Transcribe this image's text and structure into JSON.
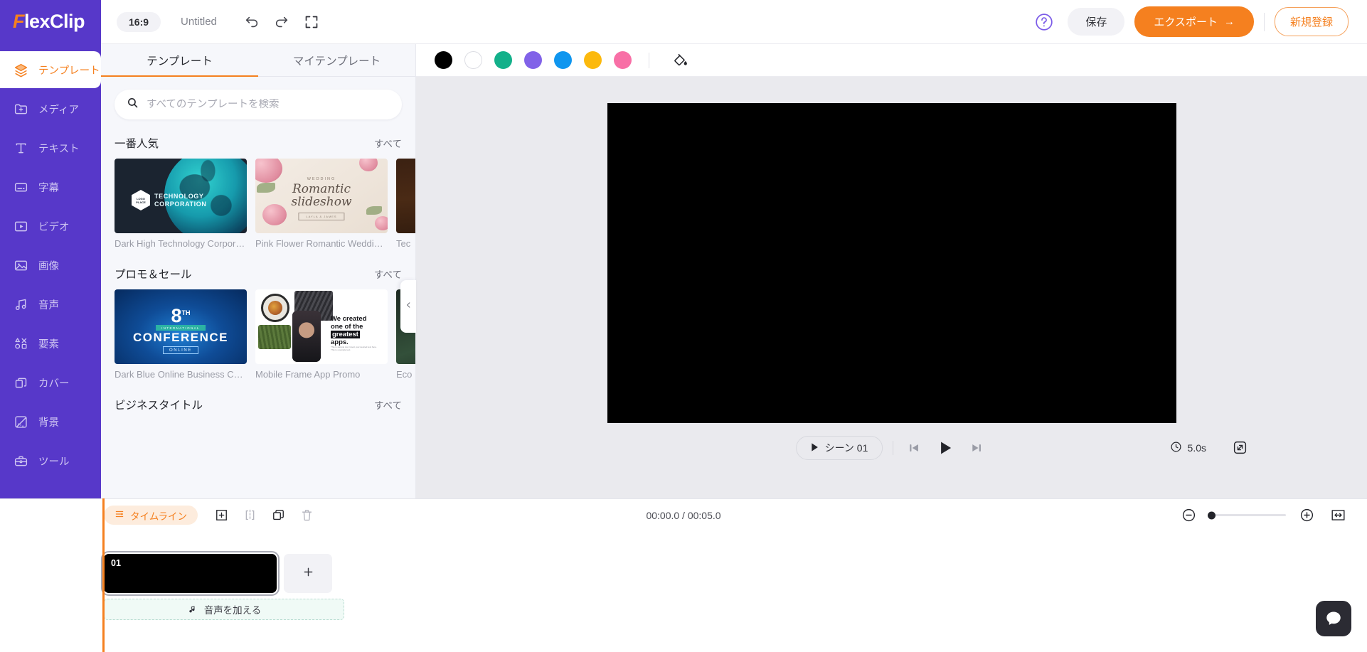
{
  "app": {
    "logo_f": "F",
    "logo_rest": "lexClip"
  },
  "header": {
    "ratio": "16:9",
    "project_title": "Untitled",
    "undo_icon": "undo-icon",
    "redo_icon": "redo-icon",
    "fullscreen_icon": "expand-icon",
    "help_icon": "help-circle-icon",
    "save_label": "保存",
    "export_label": "エクスポート",
    "export_arrow": "→",
    "signup_label": "新規登録"
  },
  "sidebar": {
    "items": [
      {
        "label": "テンプレート",
        "icon": "layers-icon",
        "active": true
      },
      {
        "label": "メディア",
        "icon": "media-folder-icon",
        "active": false
      },
      {
        "label": "テキスト",
        "icon": "text-t-icon",
        "active": false
      },
      {
        "label": "字幕",
        "icon": "subtitle-icon",
        "active": false
      },
      {
        "label": "ビデオ",
        "icon": "video-play-icon",
        "active": false
      },
      {
        "label": "画像",
        "icon": "image-icon",
        "active": false
      },
      {
        "label": "音声",
        "icon": "music-note-icon",
        "active": false
      },
      {
        "label": "要素",
        "icon": "shapes-icon",
        "active": false
      },
      {
        "label": "カバー",
        "icon": "cover-layers-icon",
        "active": false
      },
      {
        "label": "背景",
        "icon": "background-icon",
        "active": false
      },
      {
        "label": "ツール",
        "icon": "toolbox-icon",
        "active": false
      }
    ]
  },
  "panel": {
    "tabs": [
      {
        "label": "テンプレート",
        "active": true
      },
      {
        "label": "マイテンプレート",
        "active": false
      }
    ],
    "search": {
      "placeholder": "すべてのテンプレートを検索",
      "value": "",
      "icon": "search-icon"
    },
    "see_all_label": "すべて",
    "collapse_icon": "chevron-left-icon",
    "sections": [
      {
        "title": "一番人気",
        "see_all": "すべて",
        "cards": [
          {
            "name": "Dark High Technology Corporate...",
            "art": "tech",
            "art_text": {
              "line1": "TECHNOLOGY",
              "line2": "CORPORATION",
              "logo1": "LOGO",
              "logo2": "PLACE"
            }
          },
          {
            "name": "Pink Flower Romantic Wedding ...",
            "art": "wedding",
            "art_text": {
              "kicker": "WEDDING",
              "title1": "Romantic",
              "title2": "slideshow",
              "sub": "LAYLA & JAMES"
            }
          },
          {
            "name": "Tec",
            "art": "brown",
            "art_text": {}
          }
        ]
      },
      {
        "title": "プロモ＆セール",
        "see_all": "すべて",
        "cards": [
          {
            "name": "Dark Blue Online Business Confe...",
            "art": "conference",
            "art_text": {
              "num": "8",
              "sup": "TH",
              "band": "INTERNATIONAL",
              "main": "CONFERENCE",
              "online": "ONLINE"
            }
          },
          {
            "name": "Mobile Frame App Promo",
            "art": "app",
            "art_text": {
              "l1": "We created",
              "l2": "one of the",
              "l3": "greatest",
              "l4": "apps.",
              "fine": "This is sample text. Insert your desired text here. This is a sample text."
            }
          },
          {
            "name": "Eco",
            "art": "eco",
            "art_text": {}
          }
        ]
      },
      {
        "title": "ビジネスタイトル",
        "see_all": "すべて",
        "cards": []
      }
    ]
  },
  "stage": {
    "colors": [
      {
        "name": "black-swatch",
        "hex": "#000000"
      },
      {
        "name": "white-swatch",
        "hex": "#ffffff"
      },
      {
        "name": "green-swatch",
        "hex": "#13b08a"
      },
      {
        "name": "purple-swatch",
        "hex": "#8162e8"
      },
      {
        "name": "blue-swatch",
        "hex": "#0f96ef"
      },
      {
        "name": "yellow-swatch",
        "hex": "#fcb90d"
      },
      {
        "name": "pink-swatch",
        "hex": "#f86fa6"
      }
    ],
    "fill_icon": "paint-bucket-icon",
    "canvas_color": "#000000"
  },
  "player": {
    "scene_label": "シーン 01",
    "scene_play_icon": "play-small-icon",
    "prev_icon": "skip-previous-icon",
    "play_icon": "play-icon",
    "next_icon": "skip-next-icon",
    "clock_icon": "clock-icon",
    "duration": "5.0s",
    "expand_icon": "expand-arrows-icon"
  },
  "timeline": {
    "mode_label": "タイムライン",
    "mode_icon": "timeline-icon",
    "tools": [
      {
        "name": "add-clip-button",
        "icon": "plus-square-icon"
      },
      {
        "name": "split-clip-button",
        "icon": "split-icon"
      },
      {
        "name": "duplicate-clip-button",
        "icon": "duplicate-icon"
      },
      {
        "name": "delete-clip-button",
        "icon": "trash-icon"
      }
    ],
    "time_display": "00:00.0 / 00:05.0",
    "zoom_out_icon": "minus-circle-icon",
    "zoom_in_icon": "plus-circle-icon",
    "fit_icon": "fit-width-icon",
    "zoom_value": 0,
    "clips": [
      {
        "number": "01",
        "color": "#000000",
        "selected": true
      }
    ],
    "add_scene_icon": "plus-icon",
    "audio_track": {
      "label": "音声を加える",
      "icon": "music-note-icon"
    }
  },
  "chat": {
    "icon": "chat-bubble-icon"
  }
}
